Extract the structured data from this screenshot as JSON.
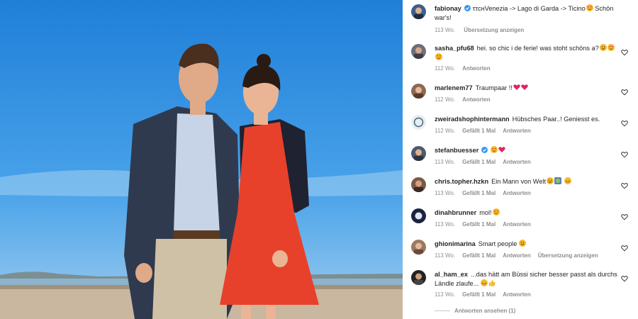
{
  "post": {
    "author": "fabionay",
    "caption": "ττснVenezia -> Lago di Garda -> Ticino",
    "caption_tail": " Schön war's!",
    "time": "113 Wo.",
    "translate": "Übersetzung anzeigen"
  },
  "comments": [
    {
      "user": "sasha_pfu68",
      "text": "hei. so chic i de ferie! was stoht schöns a?",
      "time": "112 Wo.",
      "likes": "",
      "reply": "Antworten",
      "translate": ""
    },
    {
      "user": "marlenem77",
      "text": "Traumpaar !!",
      "time": "112 Wo.",
      "likes": "",
      "reply": "Antworten",
      "translate": ""
    },
    {
      "user": "zweiradshophintermann",
      "text": "Hübsches Paar..! Geniesst es.",
      "time": "112 Wo.",
      "likes": "Gefällt 1 Mal",
      "reply": "Antworten",
      "translate": ""
    },
    {
      "user": "stefanbuesser",
      "text": "",
      "time": "113 Wo.",
      "likes": "Gefällt 1 Mal",
      "reply": "Antworten",
      "translate": ""
    },
    {
      "user": "chris.topher.hzkn",
      "text": "Ein Mann von Welt",
      "time": "113 Wo.",
      "likes": "Gefällt 1 Mal",
      "reply": "Antworten",
      "translate": ""
    },
    {
      "user": "dinahbrunner",
      "text": "mol!",
      "time": "113 Wo.",
      "likes": "Gefällt 1 Mal",
      "reply": "Antworten",
      "translate": ""
    },
    {
      "user": "ghionimarina",
      "text": "Smart people",
      "time": "113 Wo.",
      "likes": "Gefällt 1 Mal",
      "reply": "Antworten",
      "translate": "Übersetzung anzeigen"
    },
    {
      "user": "al_ham_ex",
      "text": "...das hätt am Büssi sicher besser passt als durchs Ländle zlaufe...",
      "time": "113 Wo.",
      "likes": "Gefällt 1 Mal",
      "reply": "Antworten",
      "translate": ""
    }
  ],
  "view_replies": "Antworten ansehen (1)",
  "colors": {
    "sky": "#2f8fe0",
    "dress": "#e8412b",
    "verified": "#3897f0",
    "muted": "#8e8e8e"
  }
}
